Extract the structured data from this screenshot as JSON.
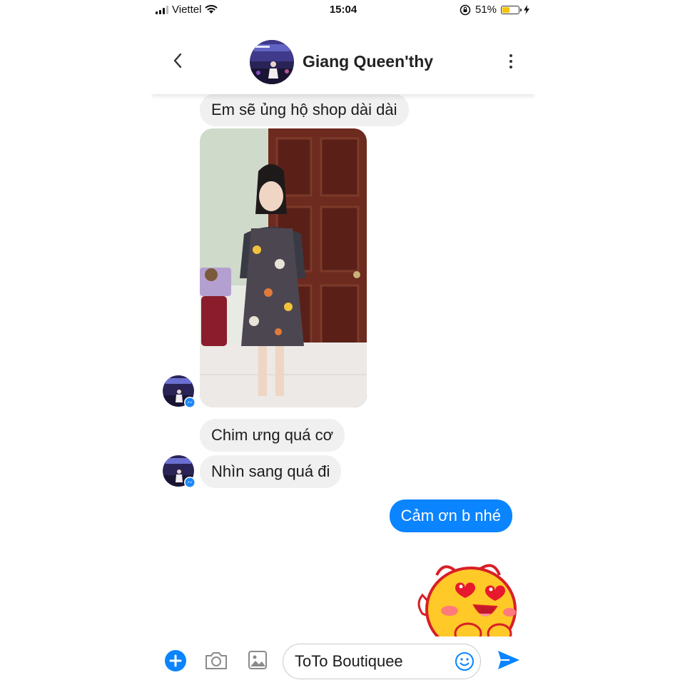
{
  "status_bar": {
    "carrier": "Viettel",
    "time": "15:04",
    "battery": "51%",
    "battery_level": 0.51,
    "icons": [
      "signal-icon",
      "wifi-icon",
      "rotation-lock-icon",
      "battery-icon",
      "charging-bolt-icon"
    ]
  },
  "header": {
    "contact_name": "Giang Queen'thy",
    "icons": [
      "back-chevron-icon",
      "more-vertical-icon"
    ]
  },
  "messages": [
    {
      "from": "contact",
      "type": "text",
      "text": "Em sẽ ủng hộ shop dài dài"
    },
    {
      "from": "contact",
      "type": "photo"
    },
    {
      "from": "contact",
      "type": "text",
      "text": "Chim ưng quá cơ"
    },
    {
      "from": "contact",
      "type": "text",
      "text": "Nhìn sang quá đi"
    },
    {
      "from": "me",
      "type": "text",
      "text": "Cảm ơn b nhé"
    },
    {
      "from": "me",
      "type": "sticker",
      "sticker": "heart-eyes-chick-sticker"
    }
  ],
  "composer": {
    "input_value": "ToTo Boutiquee",
    "icons": [
      "plus-icon",
      "camera-icon",
      "gallery-icon",
      "emoji-icon",
      "send-icon"
    ]
  },
  "colors": {
    "accent": "#0a84ff",
    "incoming_bubble": "#f0f0f0",
    "battery_fill": "#f4c20d"
  }
}
